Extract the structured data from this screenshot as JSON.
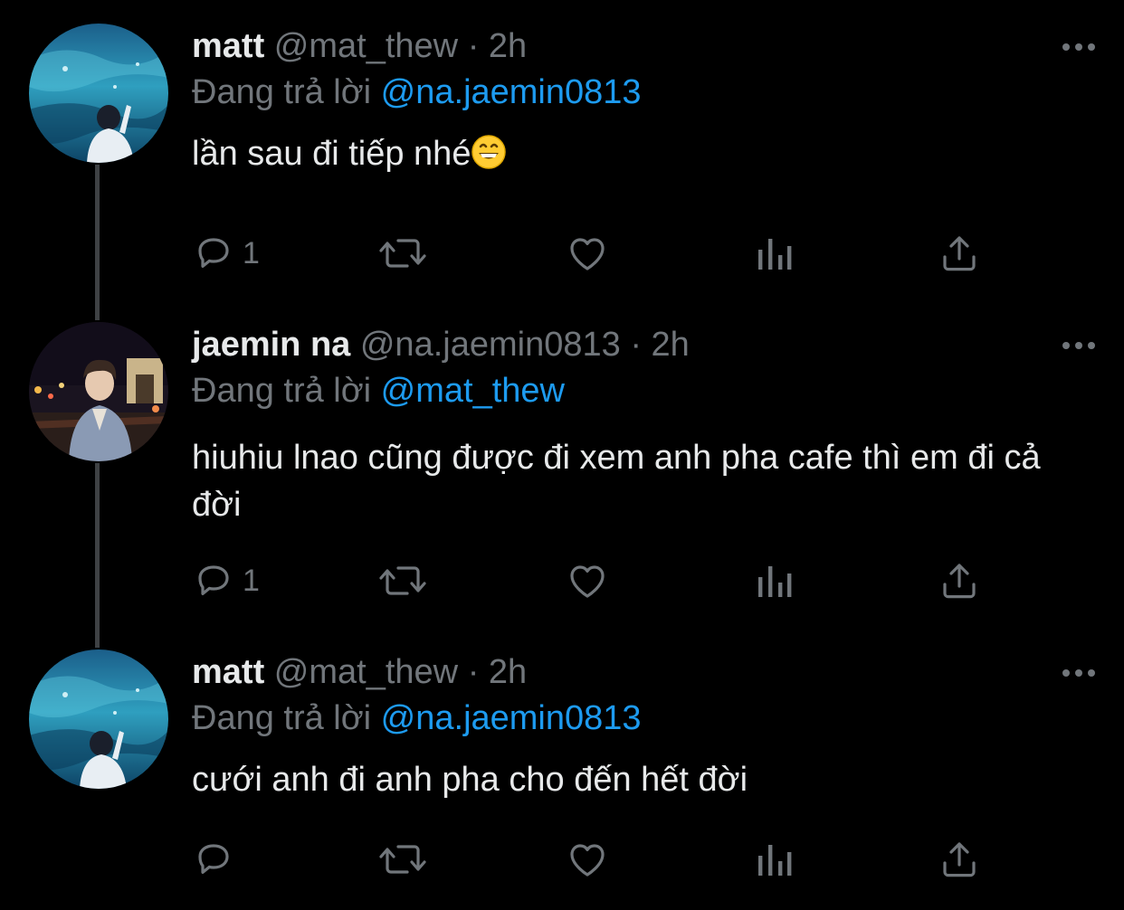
{
  "tweets": [
    {
      "name": "matt",
      "handle": "@mat_thew",
      "time": "· 2h",
      "reply_prefix": "Đang trả lời",
      "reply_to": "@na.jaemin0813",
      "text": "lần sau đi tiếp nhé",
      "emoji": "grinning-face-emoji",
      "reply_count": "1"
    },
    {
      "name": "jaemin na",
      "handle": "@na.jaemin0813",
      "time": "· 2h",
      "reply_prefix": "Đang trả lời",
      "reply_to": "@mat_thew",
      "text": "hiuhiu lnao cũng được đi xem anh pha cafe thì em đi cả đời",
      "reply_count": "1"
    },
    {
      "name": "matt",
      "handle": "@mat_thew",
      "time": "· 2h",
      "reply_prefix": "Đang trả lời",
      "reply_to": "@na.jaemin0813",
      "text": "cưới anh đi anh pha cho đến hết đời",
      "reply_count": ""
    }
  ],
  "icons": {
    "reply": "reply-bubble-icon",
    "retweet": "retweet-icon",
    "like": "heart-icon",
    "analytics": "bar-chart-icon",
    "share": "share-upload-icon",
    "more": "more-dots-icon"
  },
  "colors": {
    "background": "#000000",
    "text": "#e7e9ea",
    "muted": "#71767b",
    "accent": "#1d9bf0",
    "thread_line": "#3e4144"
  }
}
